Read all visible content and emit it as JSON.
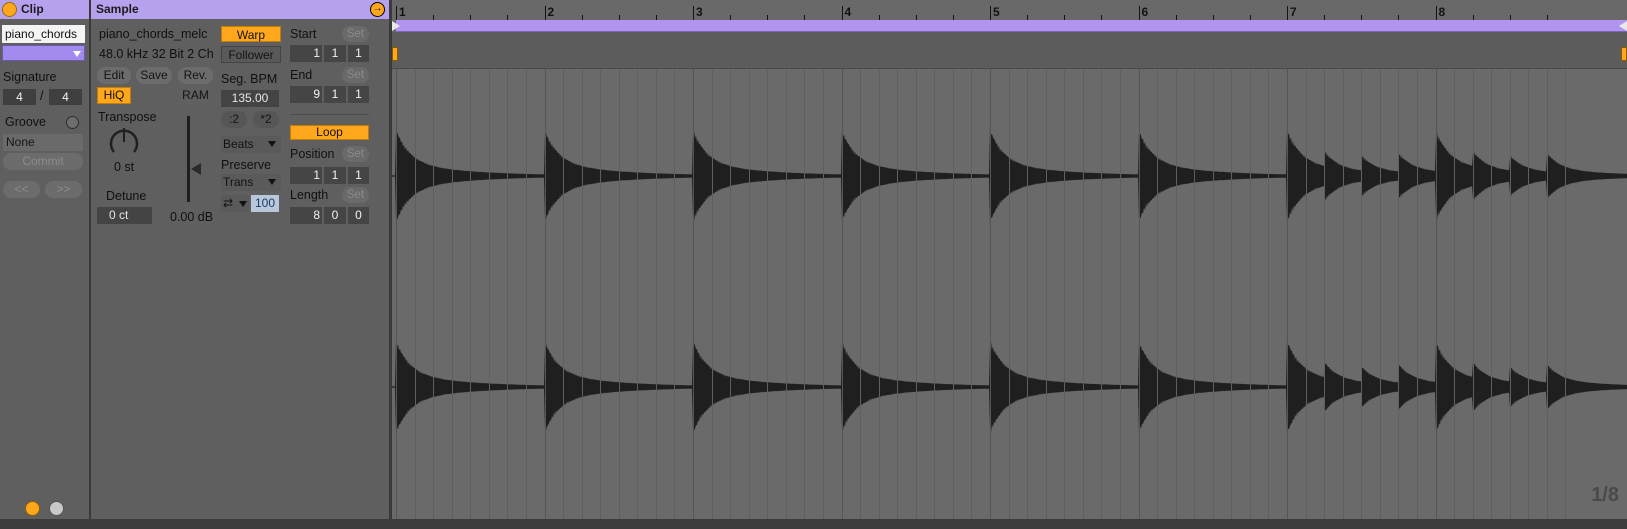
{
  "clip": {
    "title": "Clip",
    "name": "piano_chords",
    "signature_label": "Signature",
    "sig_num": "4",
    "sig_sep": "/",
    "sig_den": "4",
    "groove_label": "Groove",
    "groove_value": "None",
    "commit_label": "Commit",
    "prev_label": "<<",
    "next_label": ">>"
  },
  "sample": {
    "title": "Sample",
    "filename": "piano_chords_melc",
    "format": "48.0 kHz 32 Bit 2 Ch",
    "edit_label": "Edit",
    "save_label": "Save",
    "rev_label": "Rev.",
    "hiq_label": "HiQ",
    "ram_label": "RAM",
    "transpose_label": "Transpose",
    "transpose_value": "0 st",
    "detune_label": "Detune",
    "detune_value": "0 ct",
    "gain_value": "0.00 dB",
    "warp_label": "Warp",
    "follower_label": "Follower",
    "seg_bpm_label": "Seg. BPM",
    "seg_bpm_value": "135.00",
    "half_label": ":2",
    "double_label": "*2",
    "warp_mode": "Beats",
    "preserve_label": "Preserve",
    "preserve_value": "Trans",
    "loop_mode_value": "100",
    "start_label": "Start",
    "start": [
      "1",
      "1",
      "1"
    ],
    "end_label": "End",
    "end": [
      "9",
      "1",
      "1"
    ],
    "loop_label": "Loop",
    "position_label": "Position",
    "position": [
      "1",
      "1",
      "1"
    ],
    "length_label": "Length",
    "length": [
      "8",
      "0",
      "0"
    ],
    "set_label": "Set"
  },
  "editor": {
    "bars": [
      "1",
      "2",
      "3",
      "4",
      "5",
      "6",
      "7",
      "8"
    ],
    "zoom_label": "1/8"
  },
  "colors": {
    "accent_purple": "#b6a1ee",
    "accent_orange": "#ffa71c",
    "panel_bg": "#5f5f5f"
  },
  "icons": [
    "clip-active-icon",
    "sample-launch-icon",
    "hotswap-icon",
    "expand-icon",
    "groove-hotswap-icon",
    "loop-direction-icon",
    "chevron-down-icon"
  ]
}
